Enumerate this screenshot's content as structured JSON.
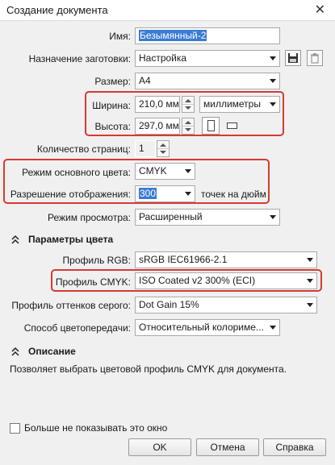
{
  "window": {
    "title": "Создание документа",
    "close_glyph": "✕"
  },
  "form": {
    "name": {
      "label": "Имя:",
      "value": "Безымянный-2"
    },
    "preset": {
      "label": "Назначение заготовки:",
      "value": "Настройка"
    },
    "size": {
      "label": "Размер:",
      "value": "A4"
    },
    "width": {
      "label": "Ширина:",
      "value": "210,0 мм"
    },
    "units": {
      "value": "миллиметры"
    },
    "height": {
      "label": "Высота:",
      "value": "297,0 мм"
    },
    "pages": {
      "label": "Количество страниц:",
      "value": "1"
    },
    "color_mode": {
      "label": "Режим основного цвета:",
      "value": "CMYK"
    },
    "resolution": {
      "label": "Разрешение отображения:",
      "value": "300",
      "unit": "точек на дюйм"
    },
    "view_mode": {
      "label": "Режим просмотра:",
      "value": "Расширенный"
    }
  },
  "color_settings": {
    "header": "Параметры цвета",
    "rgb": {
      "label": "Профиль RGB:",
      "value": "sRGB IEC61966-2.1"
    },
    "cmyk": {
      "label": "Профиль CMYK:",
      "value": "ISO Coated v2 300% (ECI)"
    },
    "gray": {
      "label": "Профиль оттенков серого:",
      "value": "Dot Gain 15%"
    },
    "intent": {
      "label": "Способ цветопередачи:",
      "value": "Относительный колориме..."
    }
  },
  "description": {
    "header": "Описание",
    "text": "Позволяет выбрать цветовой профиль CMYK для документа."
  },
  "footer": {
    "dont_show": "Больше не показывать это окно",
    "ok": "OK",
    "cancel": "Отмена",
    "help": "Справка"
  },
  "colors": {
    "highlight_box": "#d63a32",
    "selection": "#3a7bd5"
  }
}
